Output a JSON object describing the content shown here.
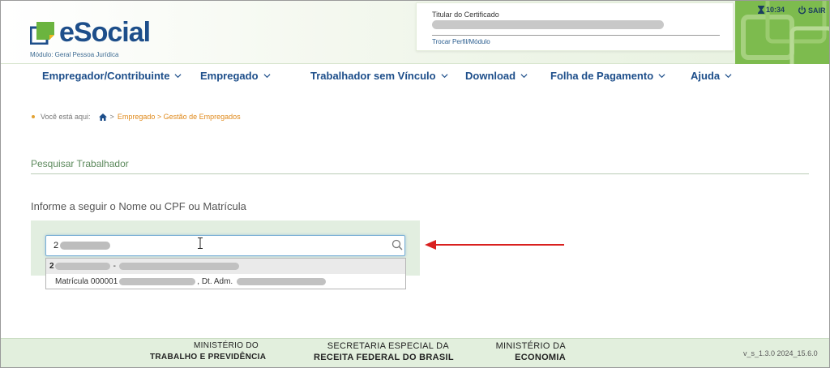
{
  "header": {
    "app_name": "eSocial",
    "module": "Módulo: Geral Pessoa Jurídica",
    "certificate_title": "Titular do Certificado",
    "change_profile": "Trocar Perfil/Módulo",
    "time": "10:34",
    "logout": "SAIR"
  },
  "nav": {
    "items": [
      {
        "label": "Empregador/Contribuinte"
      },
      {
        "label": "Empregado"
      },
      {
        "label": "Trabalhador sem Vínculo"
      },
      {
        "label": "Download"
      },
      {
        "label": "Folha de Pagamento"
      },
      {
        "label": "Ajuda"
      }
    ]
  },
  "breadcrumb": {
    "prefix": "Você está aqui:",
    "sep1": ">",
    "path": "Empregado > Gestão de Empregados"
  },
  "main": {
    "section_title": "Pesquisar Trabalhador",
    "instruction": "Informe a seguir o Nome ou CPF ou Matrícula",
    "search_value": "2",
    "dropdown": {
      "row1_prefix": "2",
      "row1_sep": "-",
      "row2_label": "Matrícula 000001",
      "row2_mid": ", Dt. Adm."
    }
  },
  "footer": {
    "org1_line1": "MINISTÉRIO DO",
    "org1_line2": "TRABALHO E PREVIDÊNCIA",
    "org2_line1": "SECRETARIA ESPECIAL DA",
    "org2_line2": "RECEITA FEDERAL DO BRASIL",
    "org3_line1": "MINISTÉRIO DA",
    "org3_line2": "ECONOMIA",
    "version": "v_s_1.3.0 2024_15.6.0"
  },
  "colors": {
    "brand_blue": "#1d4e8a",
    "accent_orange": "#e08a1c",
    "panel_green": "#e2eee0",
    "arrow_red": "#d9201f"
  }
}
